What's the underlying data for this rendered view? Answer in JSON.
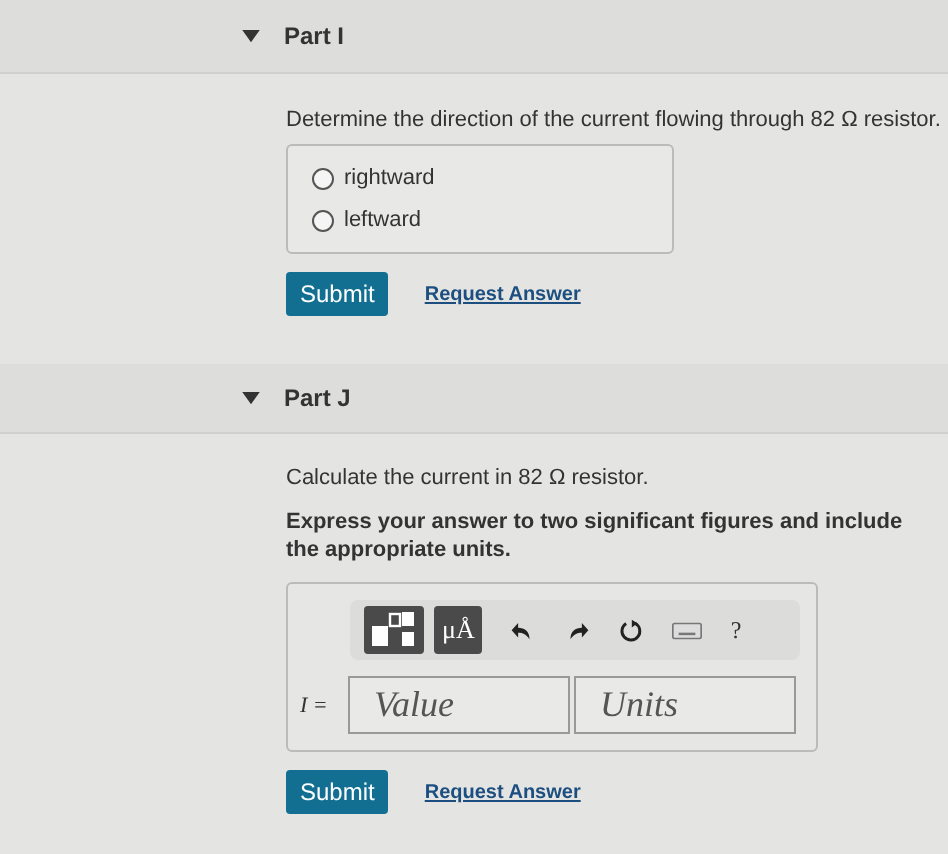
{
  "parts": [
    {
      "label": "Part I",
      "expanded": true,
      "kind": "choice",
      "prompt": "Determine the direction of the current flowing through 82 Ω resistor.",
      "options": [
        {
          "label": "rightward",
          "selected": false
        },
        {
          "label": "leftward",
          "selected": false
        }
      ],
      "submit": "Submit",
      "request": "Request Answer"
    },
    {
      "label": "Part J",
      "expanded": true,
      "kind": "answer",
      "prompt": "Calculate the current in 82 Ω resistor.",
      "instruction": "Express your answer to two significant figures and include the appropriate units.",
      "toolbar": {
        "units_button": "μÅ",
        "help": "?"
      },
      "answer": {
        "symbol": "I =",
        "value_placeholder": "Value",
        "units_placeholder": "Units"
      },
      "submit": "Submit",
      "request": "Request Answer"
    }
  ]
}
